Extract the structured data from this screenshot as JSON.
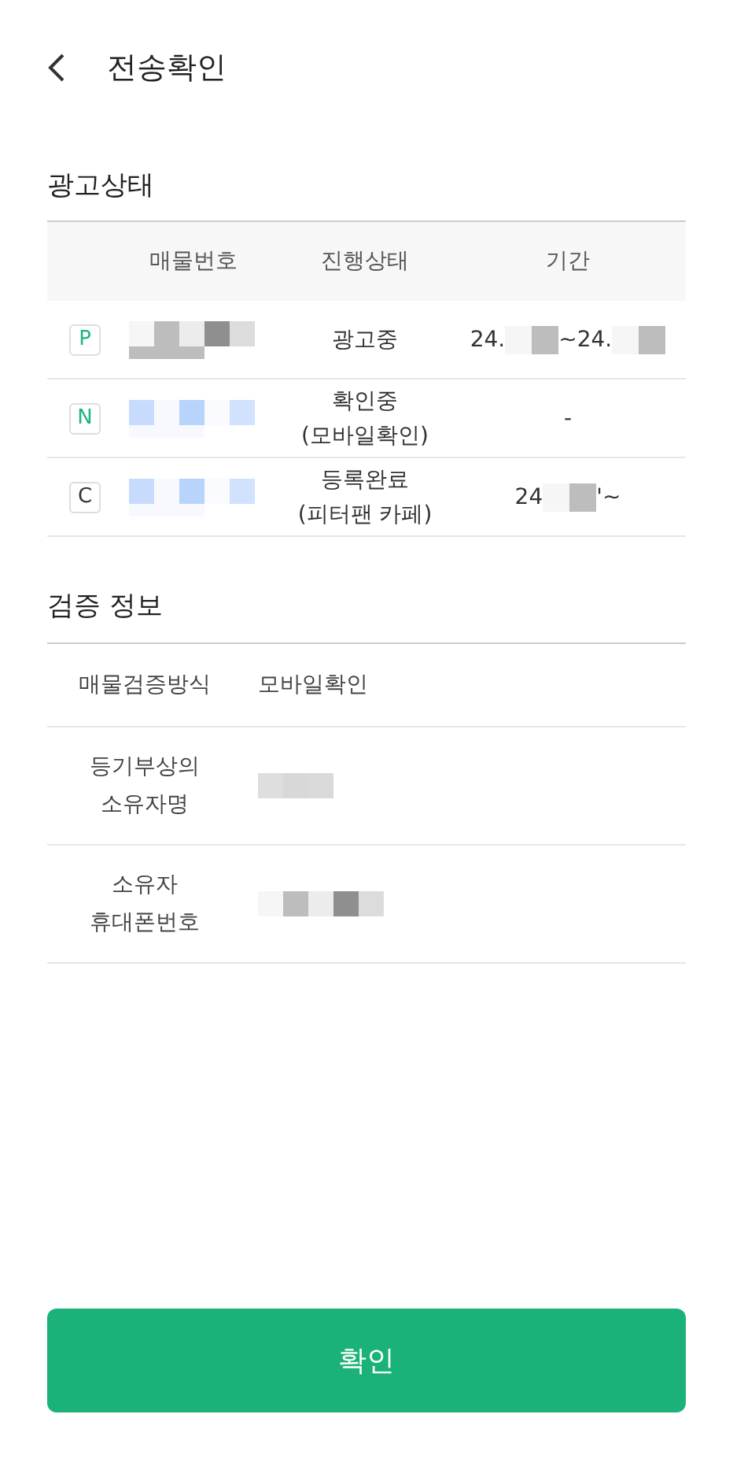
{
  "header": {
    "title": "전송확인"
  },
  "ad_status": {
    "title": "광고상태",
    "columns": [
      "매물번호",
      "진행상태",
      "기간"
    ],
    "rows": [
      {
        "badge": "P",
        "color": "#1fb57c",
        "number": [
          {
            "kind": "mosaic-gray"
          }
        ],
        "status": [
          "광고중"
        ],
        "period": [
          {
            "kind": "text",
            "text": "24."
          },
          {
            "kind": "mosaic-gray"
          },
          {
            "kind": "text",
            "text": "~24."
          },
          {
            "kind": "mosaic-gray"
          }
        ]
      },
      {
        "badge": "N",
        "color": "#1fb57c",
        "number": [
          {
            "kind": "mosaic-blue"
          }
        ],
        "status": [
          "확인중",
          "(모바일확인)"
        ],
        "period": [
          {
            "kind": "text",
            "text": "-"
          }
        ]
      },
      {
        "badge": "C",
        "color": "#333333",
        "number": [
          {
            "kind": "mosaic-blue"
          }
        ],
        "status": [
          "등록완료",
          "(피터팬 카페)"
        ],
        "period": [
          {
            "kind": "text",
            "text": "24"
          },
          {
            "kind": "mosaic-gray"
          },
          {
            "kind": "text",
            "text": "'~"
          }
        ]
      }
    ]
  },
  "verification": {
    "title": "검증 정보",
    "rows": [
      {
        "label": [
          "매물검증방식"
        ],
        "value": [
          {
            "kind": "text",
            "text": "모바일확인"
          }
        ]
      },
      {
        "label": [
          "등기부상의",
          "소유자명"
        ],
        "value": [
          {
            "kind": "mosaic-light"
          }
        ]
      },
      {
        "label": [
          "소유자",
          "휴대폰번호"
        ],
        "value": [
          {
            "kind": "mosaic-gray"
          }
        ]
      }
    ]
  },
  "confirm_button": "확인"
}
